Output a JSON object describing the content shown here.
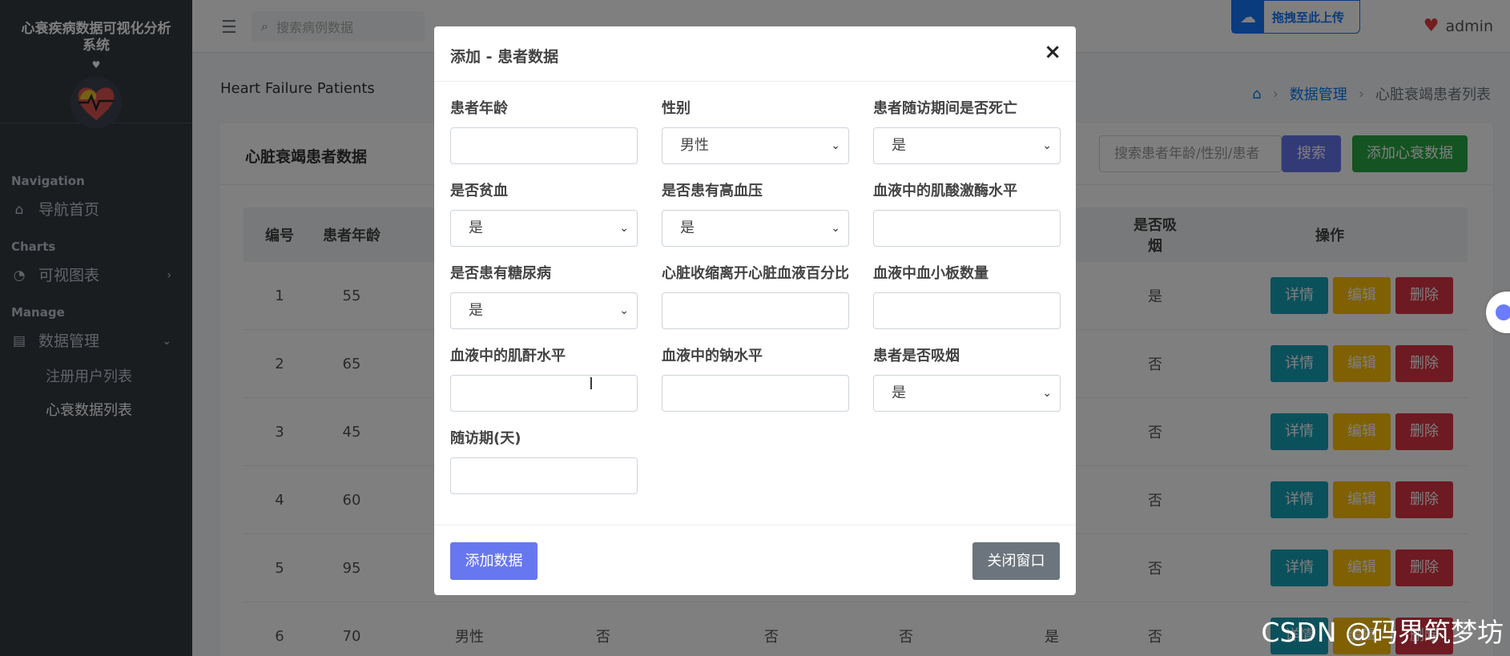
{
  "sidebar": {
    "brand_title": "心衰疾病数据可视化分析系统",
    "brand_heart": "♥",
    "sections": [
      {
        "header": "Navigation",
        "items": [
          {
            "label": "导航首页",
            "icon": "home-icon"
          }
        ]
      },
      {
        "header": "Charts",
        "items": [
          {
            "label": "可视图表",
            "icon": "pie-chart-icon"
          }
        ]
      },
      {
        "header": "Manage",
        "items": [
          {
            "label": "数据管理",
            "icon": "document-icon"
          }
        ]
      }
    ],
    "sub_items": [
      "注册用户列表",
      "心衰数据列表"
    ]
  },
  "topbar": {
    "search_placeholder": "搜索病例数据",
    "upload_label": "拖拽至此上传",
    "user_name": "admin"
  },
  "content": {
    "title": "Heart Failure Patients",
    "breadcrumb": [
      "数据管理",
      "心脏衰竭患者列表"
    ],
    "card_title": "心脏衰竭患者数据",
    "search_placeholder": "搜索患者年龄/性别/患者",
    "search_button": "搜索",
    "add_button": "添加心衰数据",
    "table": {
      "headers": [
        "编号",
        "患者年龄",
        "是否吸烟",
        "操作"
      ],
      "ops": [
        "详情",
        "编辑",
        "删除"
      ],
      "rows": [
        {
          "id": "1",
          "age": "55",
          "smoke": "是"
        },
        {
          "id": "2",
          "age": "65",
          "smoke": "否"
        },
        {
          "id": "3",
          "age": "45",
          "smoke": "否"
        },
        {
          "id": "4",
          "age": "60",
          "smoke": "否"
        },
        {
          "id": "5",
          "age": "95",
          "smoke": "否"
        },
        {
          "id": "6",
          "age": "70",
          "sex": "男性",
          "a": "否",
          "b": "否",
          "c": "否",
          "d": "是",
          "smoke": "否"
        }
      ]
    }
  },
  "modal": {
    "title": "添加 - 患者数据",
    "close": "×",
    "fields": {
      "age": {
        "label": "患者年龄",
        "value": ""
      },
      "sex": {
        "label": "性别",
        "value": "男性"
      },
      "death": {
        "label": "患者随访期间是否死亡",
        "value": "是"
      },
      "anaemia": {
        "label": "是否贫血",
        "value": "是"
      },
      "hbp": {
        "label": "是否患有高血压",
        "value": "是"
      },
      "cpk": {
        "label": "血液中的肌酸激酶水平",
        "value": ""
      },
      "diabetes": {
        "label": "是否患有糖尿病",
        "value": "是"
      },
      "ef": {
        "label": "心脏收缩离开心脏血液百分比",
        "value": ""
      },
      "platelets": {
        "label": "血液中血小板数量",
        "value": ""
      },
      "creatinine": {
        "label": "血液中的肌酐水平",
        "value": ""
      },
      "sodium": {
        "label": "血液中的钠水平",
        "value": ""
      },
      "smoking": {
        "label": "患者是否吸烟",
        "value": "是"
      },
      "time": {
        "label": "随访期(天)",
        "value": ""
      }
    },
    "submit": "添加数据",
    "close_window": "关闭窗口"
  },
  "watermark": "CSDN @码界筑梦坊"
}
